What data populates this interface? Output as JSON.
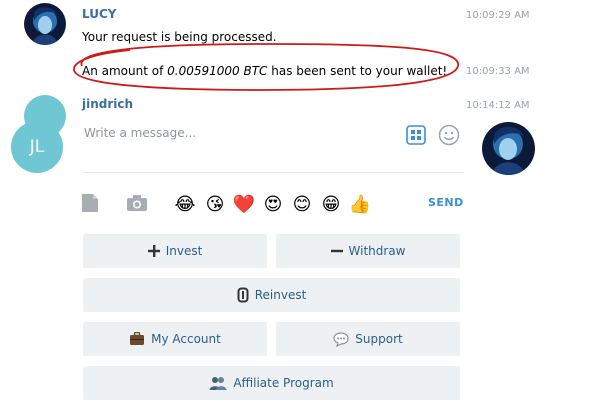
{
  "messages": [
    {
      "sender": "LUCY",
      "time": "10:09:29 AM",
      "text": "Your request is being processed."
    },
    {
      "time": "10:09:33 AM",
      "text_before": "An amount of ",
      "amount": "0.00591000 BTC",
      "text_after": " has been sent to your wallet!"
    },
    {
      "sender": "jindrich",
      "time": "10:14:12 AM"
    }
  ],
  "composer": {
    "avatar_initials": "JL",
    "placeholder": "Write a message...",
    "send_label": "SEND",
    "emojis": [
      "😂",
      "😘",
      "❤️",
      "😍",
      "😊",
      "😁",
      "👍"
    ]
  },
  "keyboard": {
    "invest": "Invest",
    "withdraw": "Withdraw",
    "reinvest": "Reinvest",
    "my_account": "My Account",
    "support": "Support",
    "affiliate": "Affiliate Program"
  },
  "colors": {
    "accent": "#3a8fd6",
    "sender": "#3a6ea5",
    "annotation": "#d01919",
    "button_bg": "#eef1f4"
  }
}
